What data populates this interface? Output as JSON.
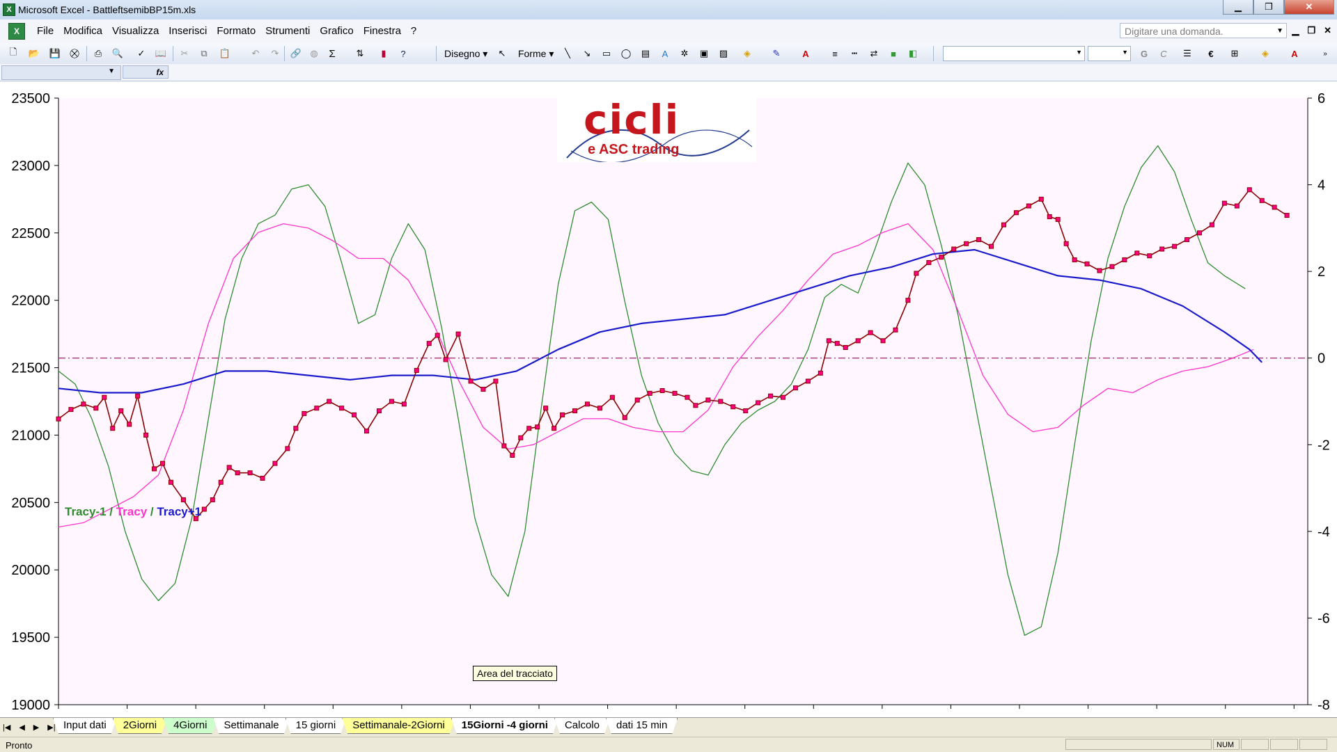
{
  "window": {
    "title": "Microsoft Excel - BattleftsemibBP15m.xls",
    "icon": "excel-icon",
    "controls": [
      "minimize-icon",
      "restore-icon",
      "close-icon"
    ]
  },
  "menu": {
    "items": [
      "File",
      "Modifica",
      "Visualizza",
      "Inserisci",
      "Formato",
      "Strumenti",
      "Grafico",
      "Finestra",
      "?"
    ],
    "ask_placeholder": "Digitare una domanda."
  },
  "toolbar": {
    "drawing_label": "Disegno",
    "shapes_label": "Forme",
    "bold_label": "G",
    "italic_label": "C",
    "euro_label": "€",
    "sum_label": "Σ"
  },
  "formula_bar": {
    "fx_label": "fx"
  },
  "chart": {
    "logo_main": "cicli",
    "logo_sub": "e ASC trading",
    "legend": {
      "sep1": " / ",
      "sep2": " / "
    },
    "tooltip": "Area del tracciato",
    "colors": {
      "price": "#8b0000",
      "price_marker": "#ff007f",
      "tracy_m1": "#2e8b2e",
      "tracy": "#ff33cc",
      "tracy_p1": "#1a1acd",
      "zero_line": "#a0206a",
      "plot_bg": "#fff6ff"
    }
  },
  "chart_data": {
    "type": "line",
    "title": "",
    "xlabel": "",
    "ylabel": "",
    "ylim": [
      19000,
      23500
    ],
    "y_ticks": [
      19000,
      19500,
      20000,
      20500,
      21000,
      21500,
      22000,
      22500,
      23000,
      23500
    ],
    "y2lim": [
      -8,
      6
    ],
    "y2_ticks": [
      -8,
      -6,
      -4,
      -2,
      0,
      2,
      4,
      6
    ],
    "y2_reference_line": 0,
    "x_count": 17,
    "grid": false,
    "legend_position": "lower-left",
    "series": [
      {
        "name": "",
        "axis": "left",
        "markers": true,
        "points": [
          [
            0,
            21120
          ],
          [
            0.3,
            21190
          ],
          [
            0.6,
            21230
          ],
          [
            0.9,
            21200
          ],
          [
            1.1,
            21280
          ],
          [
            1.3,
            21050
          ],
          [
            1.5,
            21180
          ],
          [
            1.7,
            21080
          ],
          [
            1.9,
            21290
          ],
          [
            2.1,
            21000
          ],
          [
            2.3,
            20750
          ],
          [
            2.5,
            20790
          ],
          [
            2.7,
            20650
          ],
          [
            3.0,
            20520
          ],
          [
            3.3,
            20380
          ],
          [
            3.5,
            20450
          ],
          [
            3.7,
            20520
          ],
          [
            3.9,
            20650
          ],
          [
            4.1,
            20760
          ],
          [
            4.3,
            20720
          ],
          [
            4.6,
            20720
          ],
          [
            4.9,
            20680
          ],
          [
            5.2,
            20790
          ],
          [
            5.5,
            20900
          ],
          [
            5.7,
            21050
          ],
          [
            5.9,
            21160
          ],
          [
            6.2,
            21200
          ],
          [
            6.5,
            21250
          ],
          [
            6.8,
            21200
          ],
          [
            7.1,
            21150
          ],
          [
            7.4,
            21030
          ],
          [
            7.7,
            21180
          ],
          [
            8.0,
            21250
          ],
          [
            8.3,
            21230
          ],
          [
            8.6,
            21480
          ],
          [
            8.9,
            21680
          ],
          [
            9.1,
            21740
          ],
          [
            9.3,
            21560
          ],
          [
            9.6,
            21750
          ],
          [
            9.9,
            21400
          ],
          [
            10.2,
            21340
          ],
          [
            10.5,
            21400
          ],
          [
            10.7,
            20920
          ],
          [
            10.9,
            20850
          ],
          [
            11.1,
            20980
          ],
          [
            11.3,
            21050
          ],
          [
            11.5,
            21060
          ],
          [
            11.7,
            21200
          ],
          [
            11.9,
            21050
          ],
          [
            12.1,
            21150
          ],
          [
            12.4,
            21180
          ],
          [
            12.7,
            21230
          ],
          [
            13.0,
            21200
          ],
          [
            13.3,
            21280
          ],
          [
            13.6,
            21130
          ],
          [
            13.9,
            21260
          ],
          [
            14.2,
            21310
          ],
          [
            14.5,
            21330
          ],
          [
            14.8,
            21310
          ],
          [
            15.1,
            21280
          ],
          [
            15.3,
            21220
          ],
          [
            15.6,
            21260
          ],
          [
            15.9,
            21250
          ],
          [
            16.2,
            21210
          ],
          [
            16.5,
            21180
          ],
          [
            16.8,
            21240
          ],
          [
            17.1,
            21290
          ],
          [
            17.4,
            21280
          ],
          [
            17.7,
            21350
          ],
          [
            18.0,
            21400
          ],
          [
            18.3,
            21460
          ],
          [
            18.5,
            21700
          ],
          [
            18.7,
            21680
          ],
          [
            18.9,
            21650
          ],
          [
            19.2,
            21700
          ],
          [
            19.5,
            21760
          ],
          [
            19.8,
            21700
          ],
          [
            20.1,
            21780
          ],
          [
            20.4,
            22000
          ],
          [
            20.6,
            22200
          ],
          [
            20.9,
            22280
          ],
          [
            21.2,
            22320
          ],
          [
            21.5,
            22380
          ],
          [
            21.8,
            22420
          ],
          [
            22.1,
            22450
          ],
          [
            22.4,
            22400
          ],
          [
            22.7,
            22560
          ],
          [
            23.0,
            22650
          ],
          [
            23.3,
            22700
          ],
          [
            23.6,
            22750
          ],
          [
            23.8,
            22620
          ],
          [
            24.0,
            22600
          ],
          [
            24.2,
            22420
          ],
          [
            24.4,
            22300
          ],
          [
            24.7,
            22270
          ],
          [
            25.0,
            22220
          ],
          [
            25.3,
            22250
          ],
          [
            25.6,
            22300
          ],
          [
            25.9,
            22350
          ],
          [
            26.2,
            22330
          ],
          [
            26.5,
            22380
          ],
          [
            26.8,
            22400
          ],
          [
            27.1,
            22450
          ],
          [
            27.4,
            22500
          ],
          [
            27.7,
            22560
          ],
          [
            28.0,
            22720
          ],
          [
            28.3,
            22700
          ],
          [
            28.6,
            22820
          ],
          [
            28.9,
            22740
          ],
          [
            29.2,
            22690
          ],
          [
            29.5,
            22630
          ]
        ]
      },
      {
        "name": "Tracy-1",
        "axis": "right",
        "markers": false,
        "points": [
          [
            0,
            -0.3
          ],
          [
            0.4,
            -0.6
          ],
          [
            0.8,
            -1.4
          ],
          [
            1.2,
            -2.5
          ],
          [
            1.6,
            -4.0
          ],
          [
            2.0,
            -5.1
          ],
          [
            2.4,
            -5.6
          ],
          [
            2.8,
            -5.2
          ],
          [
            3.2,
            -3.7
          ],
          [
            3.6,
            -1.4
          ],
          [
            4.0,
            0.9
          ],
          [
            4.4,
            2.3
          ],
          [
            4.8,
            3.1
          ],
          [
            5.2,
            3.3
          ],
          [
            5.6,
            3.9
          ],
          [
            6.0,
            4.0
          ],
          [
            6.4,
            3.5
          ],
          [
            6.8,
            2.2
          ],
          [
            7.2,
            0.8
          ],
          [
            7.6,
            1.0
          ],
          [
            8.0,
            2.3
          ],
          [
            8.4,
            3.1
          ],
          [
            8.8,
            2.5
          ],
          [
            9.2,
            0.7
          ],
          [
            9.6,
            -1.4
          ],
          [
            10.0,
            -3.7
          ],
          [
            10.4,
            -5.0
          ],
          [
            10.8,
            -5.5
          ],
          [
            11.2,
            -4.0
          ],
          [
            11.6,
            -1.1
          ],
          [
            12.0,
            1.7
          ],
          [
            12.4,
            3.4
          ],
          [
            12.8,
            3.6
          ],
          [
            13.2,
            3.2
          ],
          [
            13.6,
            1.3
          ],
          [
            14.0,
            -0.4
          ],
          [
            14.4,
            -1.5
          ],
          [
            14.8,
            -2.2
          ],
          [
            15.2,
            -2.6
          ],
          [
            15.6,
            -2.7
          ],
          [
            16.0,
            -2.0
          ],
          [
            16.4,
            -1.5
          ],
          [
            16.8,
            -1.2
          ],
          [
            17.2,
            -1.0
          ],
          [
            17.6,
            -0.6
          ],
          [
            18.0,
            0.2
          ],
          [
            18.4,
            1.4
          ],
          [
            18.8,
            1.7
          ],
          [
            19.2,
            1.5
          ],
          [
            19.6,
            2.5
          ],
          [
            20.0,
            3.6
          ],
          [
            20.4,
            4.5
          ],
          [
            20.8,
            4.0
          ],
          [
            21.2,
            2.6
          ],
          [
            21.6,
            1.0
          ],
          [
            22.0,
            -1.0
          ],
          [
            22.4,
            -3.0
          ],
          [
            22.8,
            -5.0
          ],
          [
            23.2,
            -6.4
          ],
          [
            23.6,
            -6.2
          ],
          [
            24.0,
            -4.5
          ],
          [
            24.4,
            -2.0
          ],
          [
            24.8,
            0.4
          ],
          [
            25.2,
            2.3
          ],
          [
            25.6,
            3.5
          ],
          [
            26.0,
            4.4
          ],
          [
            26.4,
            4.9
          ],
          [
            26.8,
            4.3
          ],
          [
            27.2,
            3.2
          ],
          [
            27.6,
            2.2
          ],
          [
            28.0,
            1.9
          ],
          [
            28.5,
            1.6
          ]
        ]
      },
      {
        "name": "Tracy",
        "axis": "right",
        "markers": false,
        "points": [
          [
            0,
            -3.9
          ],
          [
            0.6,
            -3.8
          ],
          [
            1.2,
            -3.5
          ],
          [
            1.8,
            -3.2
          ],
          [
            2.4,
            -2.7
          ],
          [
            3.0,
            -1.2
          ],
          [
            3.6,
            0.8
          ],
          [
            4.2,
            2.3
          ],
          [
            4.8,
            2.9
          ],
          [
            5.4,
            3.1
          ],
          [
            6.0,
            3.0
          ],
          [
            6.6,
            2.7
          ],
          [
            7.2,
            2.3
          ],
          [
            7.8,
            2.3
          ],
          [
            8.4,
            1.8
          ],
          [
            9.0,
            0.8
          ],
          [
            9.6,
            -0.5
          ],
          [
            10.2,
            -1.6
          ],
          [
            10.8,
            -2.1
          ],
          [
            11.4,
            -2.0
          ],
          [
            12.0,
            -1.7
          ],
          [
            12.6,
            -1.4
          ],
          [
            13.2,
            -1.4
          ],
          [
            13.8,
            -1.6
          ],
          [
            14.4,
            -1.7
          ],
          [
            15.0,
            -1.7
          ],
          [
            15.6,
            -1.2
          ],
          [
            16.2,
            -0.2
          ],
          [
            16.8,
            0.5
          ],
          [
            17.4,
            1.1
          ],
          [
            18.0,
            1.8
          ],
          [
            18.6,
            2.4
          ],
          [
            19.2,
            2.6
          ],
          [
            19.8,
            2.9
          ],
          [
            20.4,
            3.1
          ],
          [
            21.0,
            2.5
          ],
          [
            21.6,
            1.1
          ],
          [
            22.2,
            -0.4
          ],
          [
            22.8,
            -1.3
          ],
          [
            23.4,
            -1.7
          ],
          [
            24.0,
            -1.6
          ],
          [
            24.6,
            -1.1
          ],
          [
            25.2,
            -0.7
          ],
          [
            25.8,
            -0.8
          ],
          [
            26.4,
            -0.5
          ],
          [
            27.0,
            -0.3
          ],
          [
            27.6,
            -0.2
          ],
          [
            28.2,
            0.0
          ],
          [
            28.7,
            0.2
          ]
        ]
      },
      {
        "name": "Tracy+1",
        "axis": "right",
        "markers": false,
        "points": [
          [
            0,
            -0.7
          ],
          [
            1.0,
            -0.8
          ],
          [
            2.0,
            -0.8
          ],
          [
            3.0,
            -0.6
          ],
          [
            4.0,
            -0.3
          ],
          [
            5.0,
            -0.3
          ],
          [
            6.0,
            -0.4
          ],
          [
            7.0,
            -0.5
          ],
          [
            8.0,
            -0.4
          ],
          [
            9.0,
            -0.4
          ],
          [
            10.0,
            -0.5
          ],
          [
            11.0,
            -0.3
          ],
          [
            12.0,
            0.2
          ],
          [
            13.0,
            0.6
          ],
          [
            14.0,
            0.8
          ],
          [
            15.0,
            0.9
          ],
          [
            16.0,
            1.0
          ],
          [
            17.0,
            1.3
          ],
          [
            18.0,
            1.6
          ],
          [
            19.0,
            1.9
          ],
          [
            20.0,
            2.1
          ],
          [
            21.0,
            2.4
          ],
          [
            22.0,
            2.5
          ],
          [
            23.0,
            2.2
          ],
          [
            24.0,
            1.9
          ],
          [
            25.0,
            1.8
          ],
          [
            26.0,
            1.6
          ],
          [
            27.0,
            1.2
          ],
          [
            28.0,
            0.6
          ],
          [
            28.6,
            0.2
          ],
          [
            28.9,
            -0.1
          ]
        ]
      }
    ]
  },
  "sheet_tabs": [
    {
      "label": "Input dati",
      "style": "white"
    },
    {
      "label": "2Giorni",
      "style": "yellow"
    },
    {
      "label": "4Giorni",
      "style": "green"
    },
    {
      "label": "Settimanale",
      "style": "white"
    },
    {
      "label": "15 giorni",
      "style": "white"
    },
    {
      "label": "Settimanale-2Giorni",
      "style": "yellow"
    },
    {
      "label": "15Giorni -4 giorni",
      "style": "active"
    },
    {
      "label": "Calcolo",
      "style": "white"
    },
    {
      "label": "dati 15 min",
      "style": "white"
    }
  ],
  "status": {
    "text": "Pronto",
    "num": "NUM"
  }
}
